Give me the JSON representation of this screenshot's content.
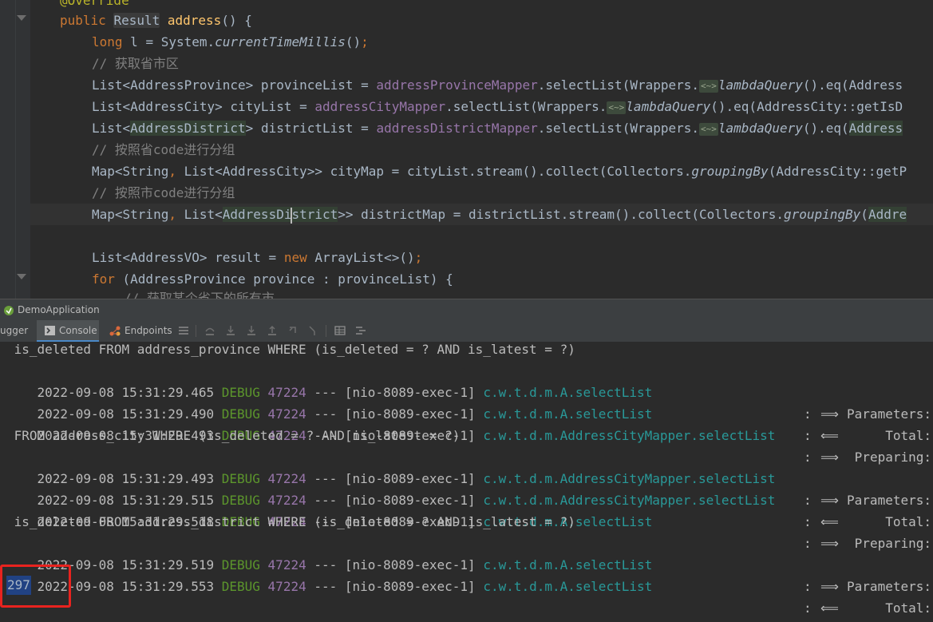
{
  "editor": {
    "lines": [
      {
        "id": "l0",
        "text": "@Override"
      },
      {
        "id": "l1",
        "text": "public Result address() {"
      },
      {
        "id": "l2",
        "text": "long l = System.currentTimeMillis();"
      },
      {
        "id": "l3",
        "text": "// 获取省市区"
      },
      {
        "id": "l4",
        "text": "List<AddressProvince> provinceList = addressProvinceMapper.selectList(Wrappers.<~>lambdaQuery().eq(Address"
      },
      {
        "id": "l5",
        "text": "List<AddressCity> cityList = addressCityMapper.selectList(Wrappers.<~>lambdaQuery().eq(AddressCity::getIsD"
      },
      {
        "id": "l6",
        "text": "List<AddressDistrict> districtList = addressDistrictMapper.selectList(Wrappers.<~>lambdaQuery().eq(Address"
      },
      {
        "id": "l7",
        "text": "// 按照省code进行分组"
      },
      {
        "id": "l8",
        "text": "Map<String, List<AddressCity>> cityMap = cityList.stream().collect(Collectors.groupingBy(AddressCity::getP"
      },
      {
        "id": "l9",
        "text": "// 按照市code进行分组"
      },
      {
        "id": "l10",
        "text": "Map<String, List<AddressDistrict>> districtMap = districtList.stream().collect(Collectors.groupingBy(Addre"
      },
      {
        "id": "l11",
        "text": "List<AddressVO> result = new ArrayList<>();"
      },
      {
        "id": "l12",
        "text": "for (AddressProvince province : provinceList) {"
      },
      {
        "id": "l13",
        "text": "// 获取某个省下的所有市"
      }
    ]
  },
  "run_window": {
    "tab_label": "DemoApplication",
    "toolbar": {
      "debugger_label": "ugger",
      "console_label": "Console",
      "endpoints_label": "Endpoints"
    }
  },
  "console": {
    "wrap_lines": [
      " is_deleted FROM address_province WHERE (is_deleted = ? AND is_latest = ?)",
      " FROM address_city WHERE (is_deleted = ? AND is_latest = ?)",
      " is_deleted FROM address_district WHERE (is_deleted = ? AND is_latest = ?)"
    ],
    "log_lines": [
      {
        "ts": "2022-09-08 15:31:29.465",
        "level": "DEBUG",
        "pid": "47224",
        "sep": "---",
        "thread": "[nio-8089-exec-1]",
        "logger": "c.w.t.d.m.A.selectList",
        "arrow": "⟹",
        "msg": "Parameters:"
      },
      {
        "ts": "2022-09-08 15:31:29.490",
        "level": "DEBUG",
        "pid": "47224",
        "sep": "---",
        "thread": "[nio-8089-exec-1]",
        "logger": "c.w.t.d.m.A.selectList",
        "arrow": "⟸",
        "msg": "Total:"
      },
      {
        "ts": "2022-09-08 15:31:29.493",
        "level": "DEBUG",
        "pid": "47224",
        "sep": "---",
        "thread": "[nio-8089-exec-1]",
        "logger": "c.w.t.d.m.AddressCityMapper.selectList",
        "arrow": "⟹",
        "msg": "Preparing:"
      },
      {
        "ts": "2022-09-08 15:31:29.493",
        "level": "DEBUG",
        "pid": "47224",
        "sep": "---",
        "thread": "[nio-8089-exec-1]",
        "logger": "c.w.t.d.m.AddressCityMapper.selectList",
        "arrow": "⟹",
        "msg": "Parameters:"
      },
      {
        "ts": "2022-09-08 15:31:29.515",
        "level": "DEBUG",
        "pid": "47224",
        "sep": "---",
        "thread": "[nio-8089-exec-1]",
        "logger": "c.w.t.d.m.AddressCityMapper.selectList",
        "arrow": "⟸",
        "msg": "Total:"
      },
      {
        "ts": "2022-09-08 15:31:29.518",
        "level": "DEBUG",
        "pid": "47224",
        "sep": "---",
        "thread": "[nio-8089-exec-1]",
        "logger": "c.w.t.d.m.A.selectList",
        "arrow": "⟹",
        "msg": "Preparing:"
      },
      {
        "ts": "2022-09-08 15:31:29.519",
        "level": "DEBUG",
        "pid": "47224",
        "sep": "---",
        "thread": "[nio-8089-exec-1]",
        "logger": "c.w.t.d.m.A.selectList",
        "arrow": "⟹",
        "msg": "Parameters:"
      },
      {
        "ts": "2022-09-08 15:31:29.553",
        "level": "DEBUG",
        "pid": "47224",
        "sep": "---",
        "thread": "[nio-8089-exec-1]",
        "logger": "c.w.t.d.m.A.selectList",
        "arrow": "⟸",
        "msg": "Total:"
      }
    ],
    "colon": ":",
    "result_value": "297"
  },
  "colors": {
    "accent_highlight": "#e8231f",
    "selection": "#214283"
  }
}
